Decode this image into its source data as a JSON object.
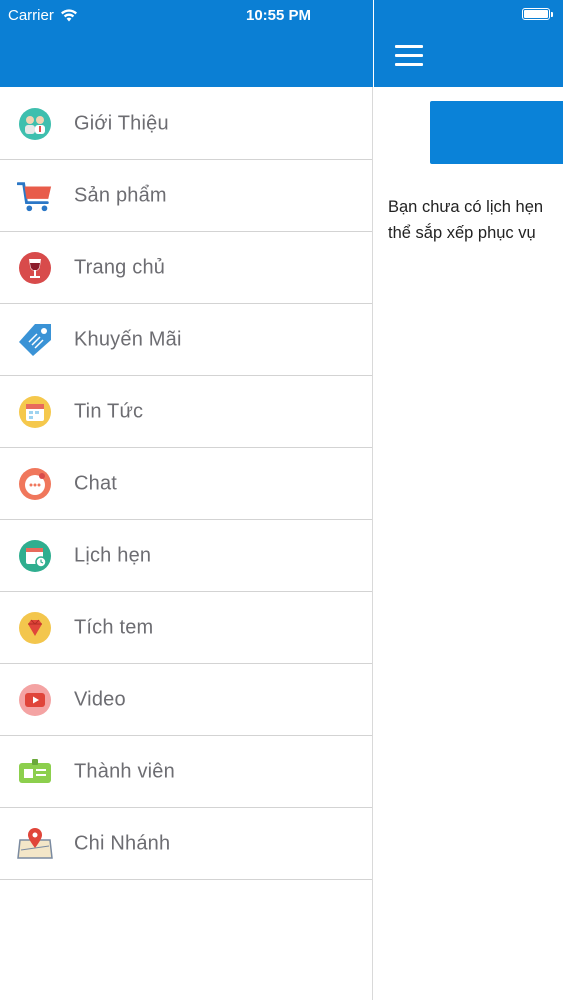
{
  "status_bar": {
    "carrier": "Carrier",
    "time": "10:55 PM"
  },
  "colors": {
    "header_blue": "#0b7fd4",
    "label_gray": "#6d6d72"
  },
  "menu": {
    "items": [
      {
        "label": "Giới Thiệu",
        "icon": "about-people-icon"
      },
      {
        "label": "Sản phẩm",
        "icon": "shopping-cart-icon"
      },
      {
        "label": "Trang chủ",
        "icon": "wine-glass-icon"
      },
      {
        "label": "Khuyến Mãi",
        "icon": "price-tag-icon"
      },
      {
        "label": "Tin Tức",
        "icon": "calendar-news-icon"
      },
      {
        "label": "Chat",
        "icon": "chat-bubble-icon"
      },
      {
        "label": "Lịch hẹn",
        "icon": "appointment-calendar-icon"
      },
      {
        "label": "Tích tem",
        "icon": "diamond-gem-icon"
      },
      {
        "label": "Video",
        "icon": "video-play-icon"
      },
      {
        "label": "Thành viên",
        "icon": "member-card-icon"
      },
      {
        "label": "Chi Nhánh",
        "icon": "map-pin-icon"
      }
    ]
  },
  "main": {
    "text_line1": "Bạn chưa có lịch hẹn",
    "text_line2": "thể sắp xếp phục vụ"
  }
}
